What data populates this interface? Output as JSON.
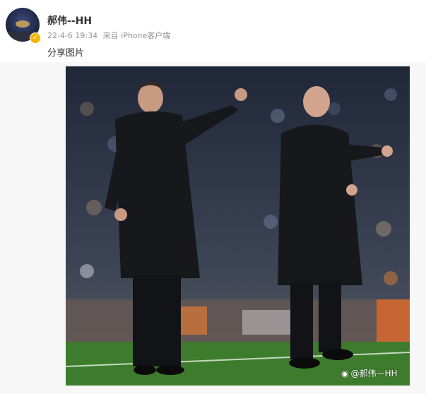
{
  "post": {
    "username": "郝伟--HH",
    "date": "22-4-6 19:34",
    "source": "来自 iPhone客户端",
    "text": "分享图片",
    "verified_icon": "verified-badge-icon"
  },
  "image": {
    "watermark": "@郝伟—HH",
    "watermark_icon": "weibo-logo-icon"
  },
  "colors": {
    "verified_badge": "#f7b500",
    "pitch_green": "#3e7c2d"
  }
}
